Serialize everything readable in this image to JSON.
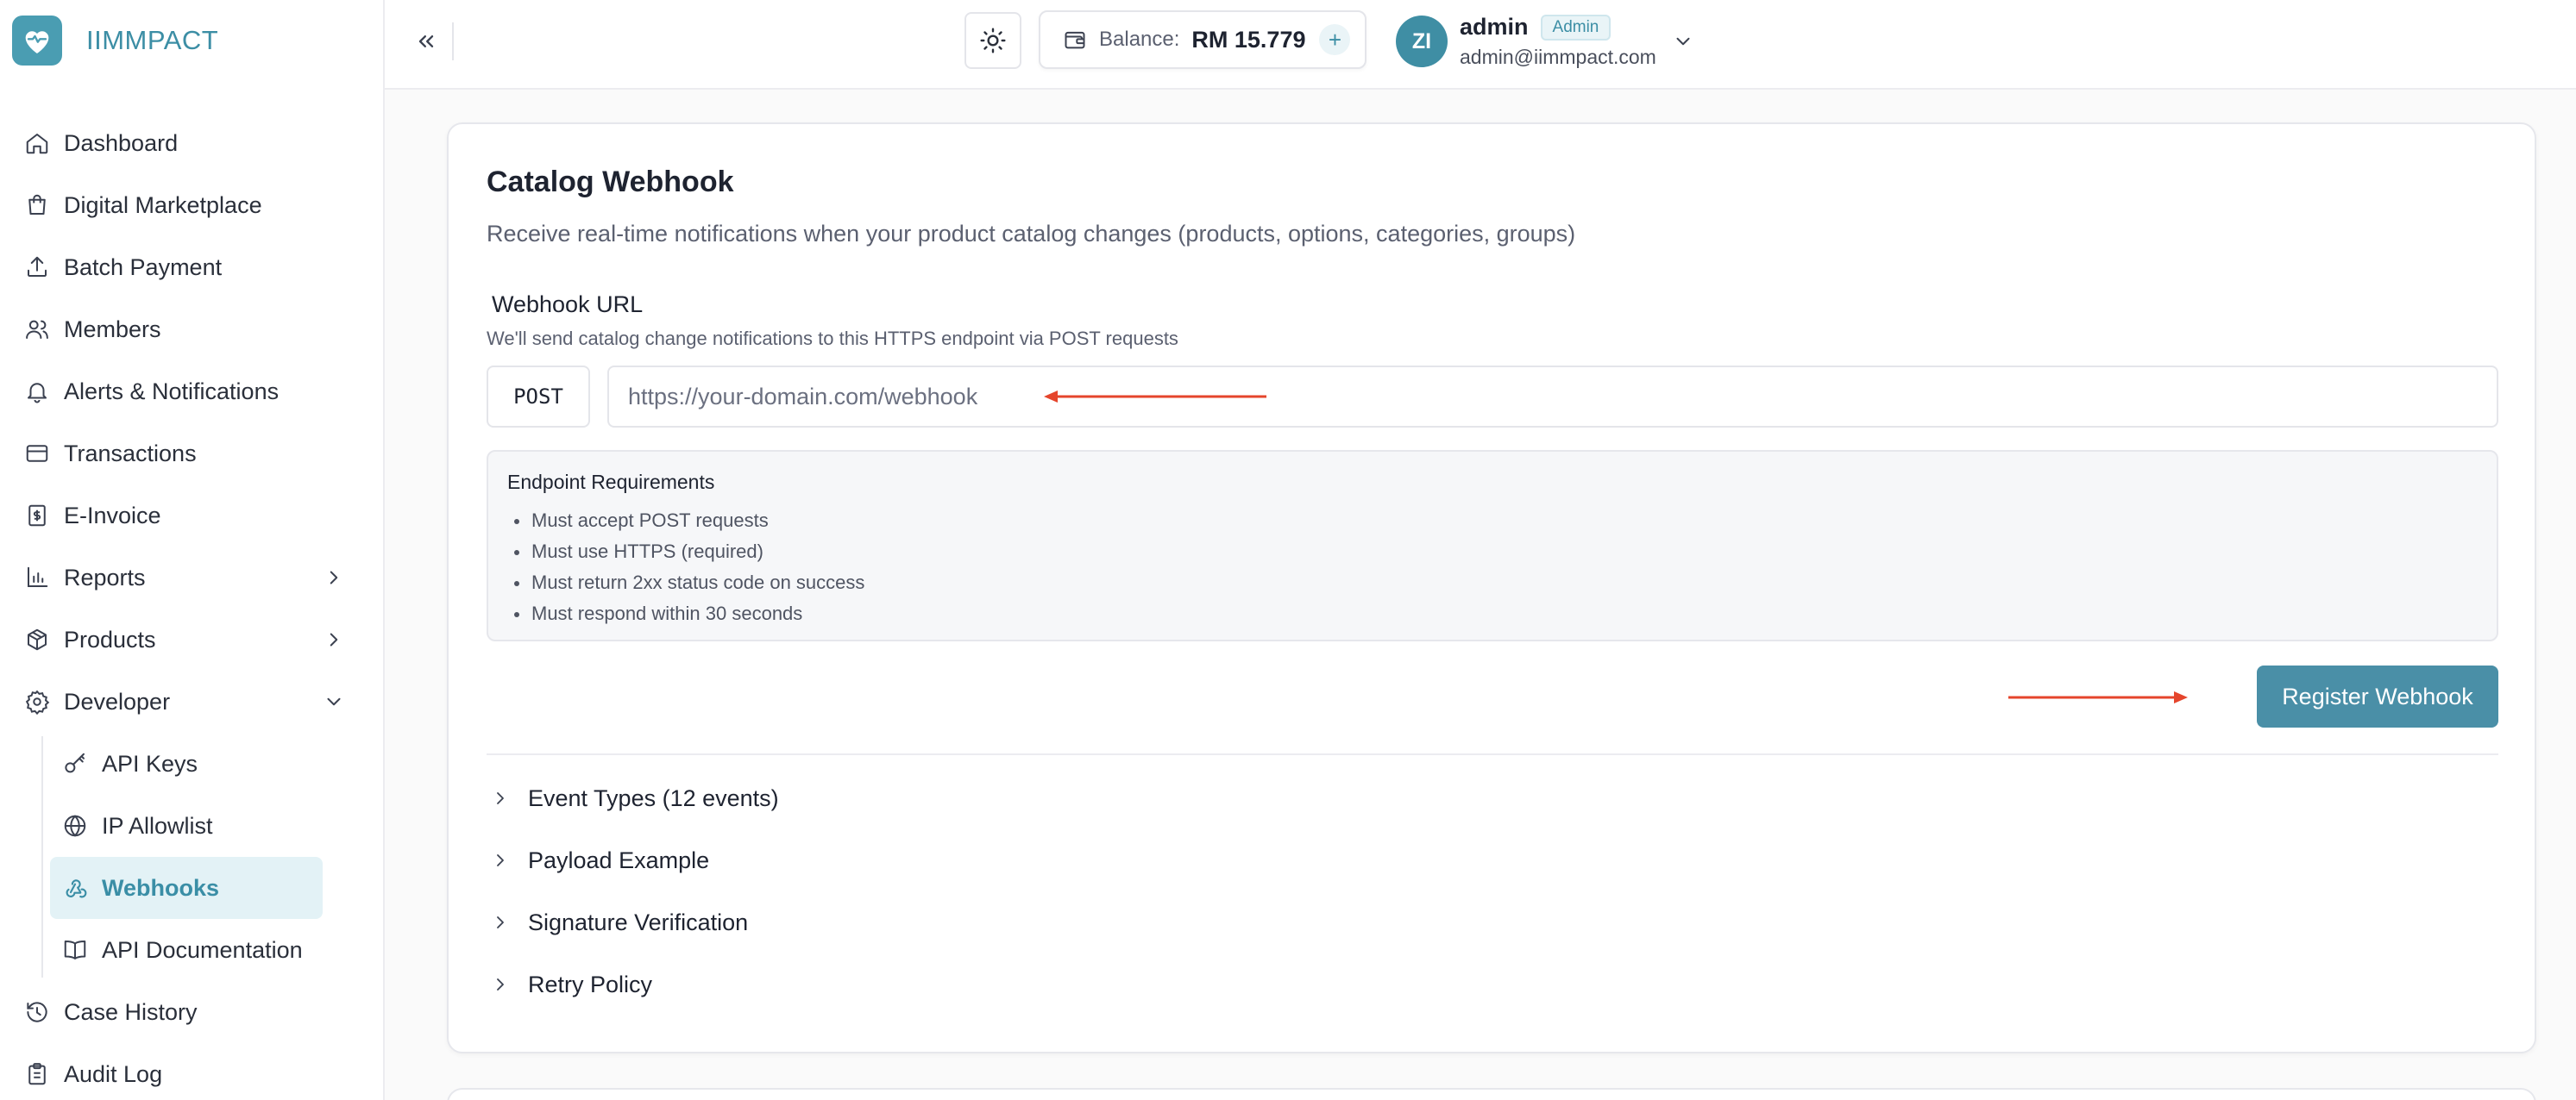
{
  "brand": {
    "name": "IIMMPACT"
  },
  "sidebar": {
    "items": [
      {
        "label": "Dashboard",
        "icon": "home-icon"
      },
      {
        "label": "Digital Marketplace",
        "icon": "shopping-bag-icon"
      },
      {
        "label": "Batch Payment",
        "icon": "upload-icon"
      },
      {
        "label": "Members",
        "icon": "users-icon"
      },
      {
        "label": "Alerts & Notifications",
        "icon": "bell-icon"
      },
      {
        "label": "Transactions",
        "icon": "credit-card-icon"
      },
      {
        "label": "E-Invoice",
        "icon": "receipt-icon"
      },
      {
        "label": "Reports",
        "icon": "bar-chart-icon"
      },
      {
        "label": "Products",
        "icon": "package-icon"
      },
      {
        "label": "Developer",
        "icon": "gear-icon"
      }
    ],
    "developer_sub": [
      {
        "label": "API Keys",
        "icon": "key-icon"
      },
      {
        "label": "IP Allowlist",
        "icon": "globe-icon"
      },
      {
        "label": "Webhooks",
        "icon": "webhook-icon",
        "active": true
      },
      {
        "label": "API Documentation",
        "icon": "book-icon"
      }
    ],
    "bottom": [
      {
        "label": "Case History",
        "icon": "history-icon"
      },
      {
        "label": "Audit Log",
        "icon": "clipboard-icon"
      }
    ]
  },
  "header": {
    "balance_label": "Balance:",
    "balance_value": "RM 15.779",
    "balance_add": "+",
    "user": {
      "initials": "ZI",
      "name": "admin",
      "role": "Admin",
      "email": "admin@iimmpact.com"
    }
  },
  "card": {
    "title": "Catalog Webhook",
    "description": "Receive real-time notifications when your product catalog changes (products, options, categories, groups)",
    "url_label": "Webhook URL",
    "url_help": "We'll send catalog change notifications to this HTTPS endpoint via POST requests",
    "method": "POST",
    "url_value": "",
    "url_placeholder": "https://your-domain.com/webhook",
    "requirements_title": "Endpoint Requirements",
    "requirements": [
      "Must accept POST requests",
      "Must use HTTPS (required)",
      "Must return 2xx status code on success",
      "Must respond within 30 seconds"
    ],
    "register_label": "Register Webhook",
    "accordions": [
      "Event Types (12 events)",
      "Payload Example",
      "Signature Verification",
      "Retry Policy"
    ]
  },
  "colors": {
    "brand": "#4a9db2",
    "accent": "#4a8fa7",
    "annotation_arrow": "#e5452c",
    "active_bg": "#e3f2f6"
  }
}
